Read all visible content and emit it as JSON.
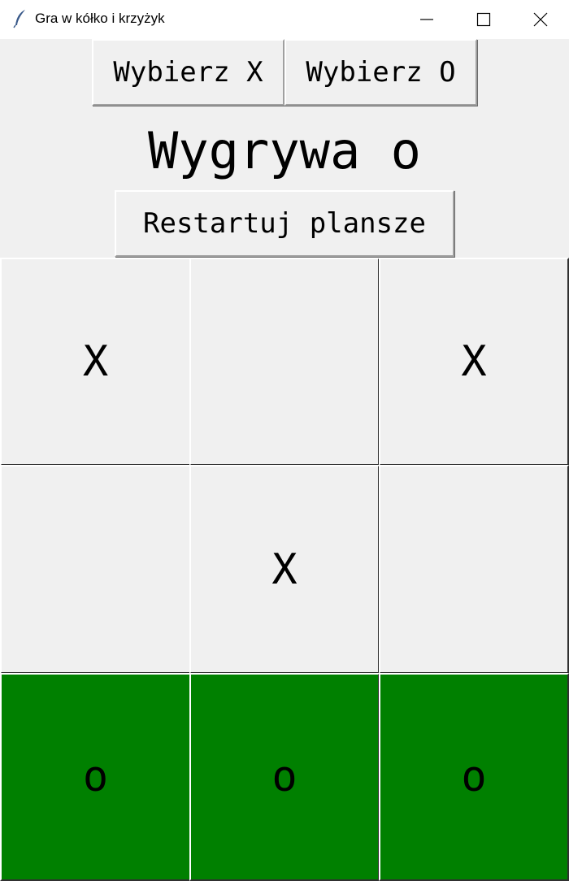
{
  "window": {
    "title": "Gra w kółko i krzyżyk",
    "app_icon": "feather-icon",
    "controls": [
      "minimize-icon",
      "maximize-icon",
      "close-icon"
    ]
  },
  "controls": {
    "choose_x_label": "Wybierz X",
    "choose_o_label": "Wybierz O",
    "status_text": "Wygrywa o",
    "restart_label": "Restartuj plansze"
  },
  "board": {
    "cells": [
      "X",
      "",
      "X",
      "",
      "X",
      "",
      "o",
      "o",
      "o"
    ],
    "winning_cells": [
      6,
      7,
      8
    ],
    "win_color": "#008000",
    "default_color": "#f0f0f0"
  }
}
